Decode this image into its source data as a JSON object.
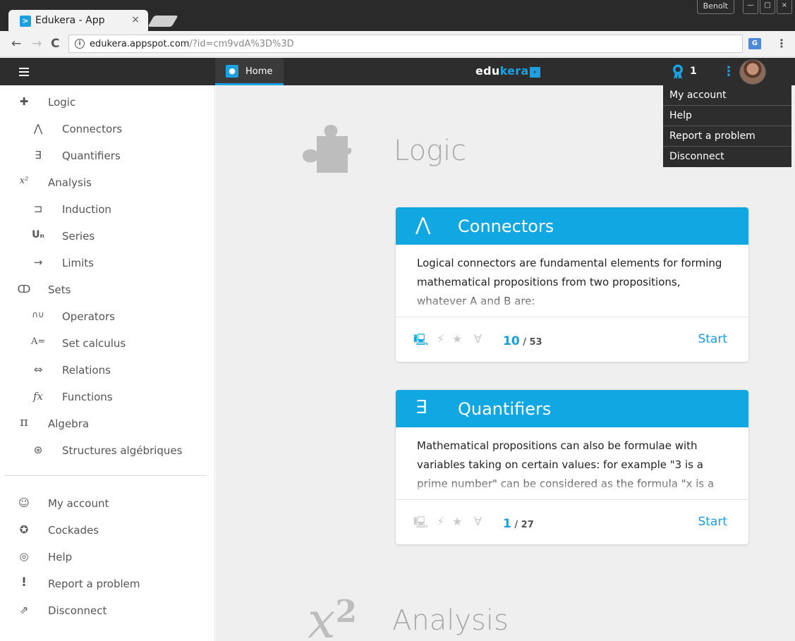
{
  "browser": {
    "tab_title": "Edukera - App",
    "tab_close": "×",
    "favicon": ">",
    "user_name": "Benoît",
    "url_host": "edukera.appspot.com",
    "url_path": "/?id=cm9vdA%3D%3D",
    "back": "←",
    "forward": "→",
    "reload": "C",
    "info": "i",
    "translate": "G",
    "menu": "⋮",
    "win_min": "—",
    "win_max": "□",
    "win_close": "×"
  },
  "header": {
    "home_label": "Home",
    "logo_main": "edu",
    "logo_accent": "kera",
    "logo_box": "›",
    "cockade_count": "1",
    "kebab": "⋮"
  },
  "dropdown": {
    "items": [
      "My account",
      "Help",
      "Report a problem",
      "Disconnect"
    ]
  },
  "sidebar": {
    "items": [
      {
        "icon": "✚",
        "label": "Logic"
      },
      {
        "icon": "⋀",
        "label": "Connectors"
      },
      {
        "icon": "∃",
        "label": "Quantifiers"
      },
      {
        "icon": "x²",
        "label": "Analysis"
      },
      {
        "icon": "⊐",
        "label": "Induction"
      },
      {
        "icon": "Uₙ",
        "label": "Series"
      },
      {
        "icon": "→",
        "label": "Limits"
      },
      {
        "icon": "ↀ",
        "label": "Sets"
      },
      {
        "icon": "∩∪",
        "label": "Operators"
      },
      {
        "icon": "A=",
        "label": "Set calculus"
      },
      {
        "icon": "⇔",
        "label": "Relations"
      },
      {
        "icon": "fx",
        "label": "Functions"
      },
      {
        "icon": "π",
        "label": "Algebra"
      },
      {
        "icon": "⊛",
        "label": "Structures algébriques"
      }
    ],
    "account_items": [
      {
        "icon": "☺",
        "label": "My account"
      },
      {
        "icon": "✪",
        "label": "Cockades"
      },
      {
        "icon": "◎",
        "label": "Help"
      },
      {
        "icon": "!",
        "label": "Report a problem"
      },
      {
        "icon": "⇗",
        "label": "Disconnect"
      }
    ]
  },
  "main": {
    "section_logic": "Logic",
    "section_analysis": "Analysis",
    "analysis_symbol_base": "x",
    "analysis_symbol_exp": "2",
    "cards": [
      {
        "symbol": "⋀",
        "title": "Connectors",
        "description": "Logical connectors are fundamental elements for forming mathematical propositions from two propositions, whatever A and B are:",
        "score": "10",
        "total": " / 53",
        "start": "Start",
        "active": true
      },
      {
        "symbol": "∃",
        "title": "Quantifiers",
        "description": "Mathematical propositions can also be formulae with variables taking on certain values: for example \"3 is a prime number\" can be considered as the formula \"x is a prime",
        "score": "1",
        "total": " / 27",
        "start": "Start",
        "active": false
      }
    ],
    "footer_icons": [
      "⚡",
      "★",
      "∀"
    ],
    "monitor_icon": "🖳"
  },
  "colors": {
    "accent": "#10a7e2",
    "header_bg": "#2d2d2d",
    "content_bg": "#efefef"
  }
}
